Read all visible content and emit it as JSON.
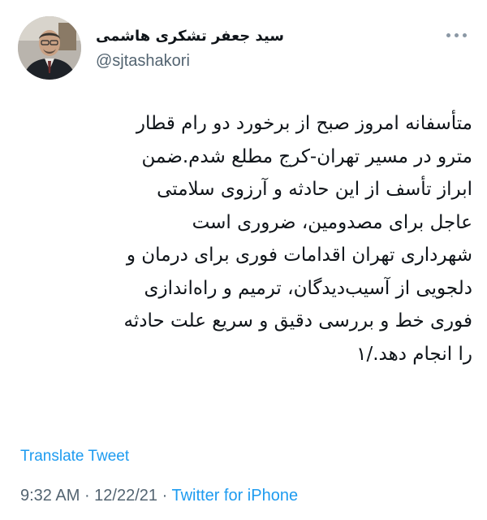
{
  "tweet": {
    "author": {
      "display_name": "سید جعفر تشکری هاشمی",
      "handle": "@sjtashakori"
    },
    "text_lines": [
      "متأسفانه امروز صبح از برخورد دو رام قطار",
      "مترو در مسیر تهران-کرج مطلع شدم.ضمن",
      "ابراز تأسف از این حادثه و آرزوی سلامتی",
      "عاجل برای مصدومین، ضروری است",
      "شهرداری تهران اقدامات فوری برای درمان و",
      "دلجویی از آسیب‌دیدگان، ترمیم و راه‌اندازی",
      "فوری خط و بررسی دقیق و سریع علت حادثه",
      "را انجام دهد./۱"
    ],
    "translate_label": "Translate Tweet",
    "time": "9:32 AM",
    "separator": " · ",
    "date": "12/22/21",
    "source": "Twitter for iPhone"
  },
  "icons": {
    "more": "more-horizontal-icon"
  },
  "colors": {
    "link": "#1d9bf0",
    "secondary_text": "#536471",
    "primary_text": "#0f1419"
  }
}
